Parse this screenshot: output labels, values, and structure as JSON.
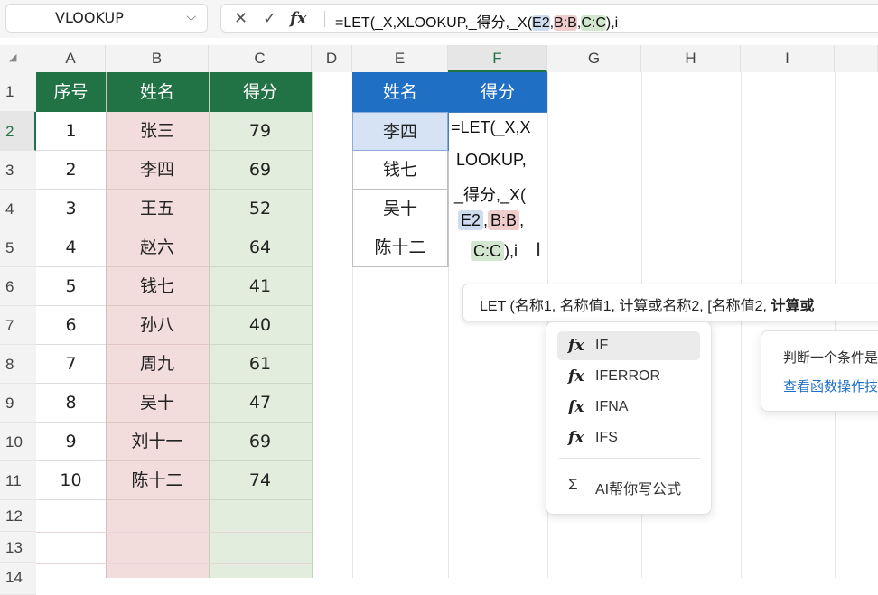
{
  "namebox": {
    "value": "VLOOKUP",
    "chevron": "⌵"
  },
  "formula_bar": {
    "cancel": "✕",
    "enter": "✓",
    "fx": "fx",
    "formula_prefix": "=LET(_X,XLOOKUP,_得分,_X(",
    "ref_e": "E2",
    "comma1": ",",
    "ref_b": "B:B",
    "comma2": ",",
    "ref_c": "C:C",
    "formula_suffix": "),i"
  },
  "columns": [
    "A",
    "B",
    "C",
    "D",
    "E",
    "F",
    "G",
    "H",
    "I"
  ],
  "rows": [
    "1",
    "2",
    "3",
    "4",
    "5",
    "6",
    "7",
    "8",
    "9",
    "10",
    "11",
    "12",
    "13",
    "14"
  ],
  "left_table": {
    "headers": [
      "序号",
      "姓名",
      "得分"
    ],
    "rows": [
      [
        "1",
        "张三",
        "79"
      ],
      [
        "2",
        "李四",
        "69"
      ],
      [
        "3",
        "王五",
        "52"
      ],
      [
        "4",
        "赵六",
        "64"
      ],
      [
        "5",
        "钱七",
        "41"
      ],
      [
        "6",
        "孙八",
        "40"
      ],
      [
        "7",
        "周九",
        "61"
      ],
      [
        "8",
        "吴十",
        "47"
      ],
      [
        "9",
        "刘十一",
        "69"
      ],
      [
        "10",
        "陈十二",
        "74"
      ]
    ]
  },
  "right_table": {
    "headers": [
      "姓名",
      "得分"
    ],
    "names": [
      "李四",
      "钱七",
      "吴十",
      "陈十二"
    ]
  },
  "edit_cell": {
    "line1": "=LET(_X,X",
    "line2": "LOOKUP,",
    "line3": "_得分,_X(",
    "line4_ref": "E2",
    "line4_comma": ",",
    "line4_ref2": "B:B",
    "line4_comma2": ",",
    "line5_ref": "C:C",
    "line5_tail": "),i"
  },
  "tooltip": {
    "text": "LET   (名称1, 名称值1, 计算或名称2, [名称值2, ",
    "bold": "计算或"
  },
  "autocomplete": {
    "items": [
      "IF",
      "IFERROR",
      "IFNA",
      "IFS"
    ],
    "selected_index": 0,
    "ai_label": "AI帮你写公式"
  },
  "info_panel": {
    "description": "判断一个条件是",
    "link": "查看函数操作技"
  },
  "colors": {
    "header_green": "#217346",
    "header_blue": "#1f6fc5",
    "pink": "#f2dcdc",
    "mint": "#e2eddd"
  }
}
